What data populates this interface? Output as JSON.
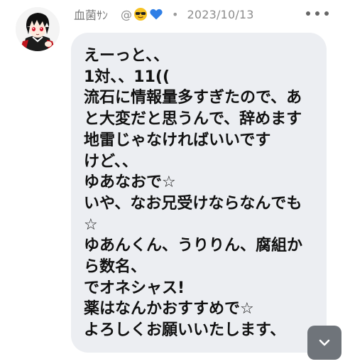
{
  "post": {
    "author_name": "血菌ｻﾝ",
    "handle": "@",
    "handle_emojis": [
      "sunglasses-face-emoji",
      "blue-heart-emoji"
    ],
    "separator": "•",
    "date": "2023/10/13",
    "message_lines": [
      "えーっと、、",
      "1対、、11((",
      "流石に情報量多すぎたので、あ",
      "と大変だと思うんで、辞めます",
      "地雷じゃなければいいです",
      "けど、、",
      "ゆあなおで☆",
      "いや、なお兄受けならなんでも",
      "☆",
      "ゆあんくん、うりりん、腐組か",
      "ら数名、",
      "でオネシャス!",
      "薬はなんかおすすめで☆",
      "よろしくお願いいたします、"
    ]
  },
  "icons": {
    "more": "more-horizontal-icon",
    "scroll": "chevron-down-icon"
  },
  "colors": {
    "bubble": "#eceef2",
    "text": "#111111",
    "meta": "#8c8c8c",
    "scroll_button": "#6f747a"
  }
}
